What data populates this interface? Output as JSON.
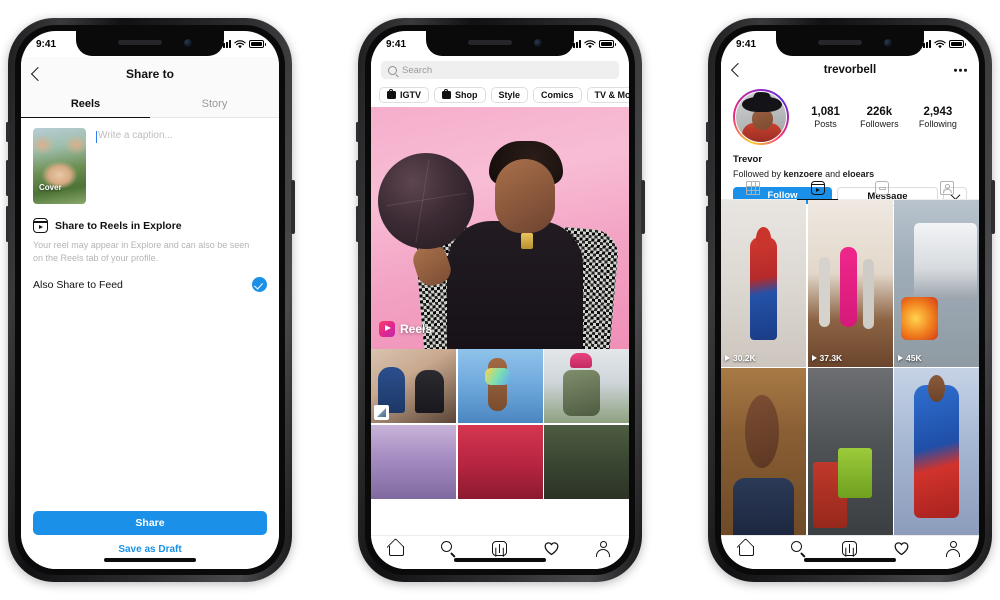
{
  "status_bar": {
    "time": "9:41",
    "signal_icon": "cellular-bars-icon",
    "wifi_icon": "wifi-icon",
    "battery_icon": "battery-icon"
  },
  "phone1": {
    "header": {
      "back_icon": "back-chevron-icon",
      "title": "Share to"
    },
    "tabs": [
      {
        "label": "Reels",
        "active": true
      },
      {
        "label": "Story",
        "active": false
      }
    ],
    "composer": {
      "cover_label": "Cover",
      "caption_placeholder": "Write a caption...",
      "caption_value": ""
    },
    "explore": {
      "icon": "reels-icon",
      "title": "Share to Reels in Explore",
      "description": "Your reel may appear in Explore and can also be seen on the Reels tab of your profile."
    },
    "feed_toggle": {
      "label": "Also Share to Feed",
      "checked": true,
      "check_icon": "check-circle-icon"
    },
    "actions": {
      "share_label": "Share",
      "draft_label": "Save as Draft"
    },
    "colors": {
      "accent": "#1a90e8"
    }
  },
  "phone2": {
    "search": {
      "icon": "search-icon",
      "placeholder": "Search",
      "value": ""
    },
    "chips": [
      {
        "label": "IGTV",
        "icon": "igtv-icon"
      },
      {
        "label": "Shop",
        "icon": "shop-bag-icon"
      },
      {
        "label": "Style",
        "icon": ""
      },
      {
        "label": "Comics",
        "icon": ""
      },
      {
        "label": "TV & Movies",
        "icon": ""
      }
    ],
    "hero": {
      "badge_label": "Reels",
      "badge_icon": "reels-icon"
    },
    "grid": [
      {
        "name": "photo-two-people-cake",
        "art": "h1",
        "tag_icon": "tagged-photo-icon"
      },
      {
        "name": "photo-glitter-hand-sky",
        "art": "h2",
        "tag_icon": ""
      },
      {
        "name": "photo-person-beanie",
        "art": "h3",
        "tag_icon": ""
      },
      {
        "name": "photo-flowers",
        "art": "h4",
        "tag_icon": ""
      },
      {
        "name": "photo-red-dress",
        "art": "h5",
        "tag_icon": ""
      },
      {
        "name": "photo-dark-green",
        "art": "h6",
        "tag_icon": ""
      }
    ],
    "nav": [
      {
        "name": "home-icon",
        "active": true
      },
      {
        "name": "search-icon",
        "active": false
      },
      {
        "name": "add-post-icon",
        "active": false
      },
      {
        "name": "heart-icon",
        "active": false
      },
      {
        "name": "profile-icon",
        "active": false
      }
    ]
  },
  "phone3": {
    "header": {
      "back_icon": "back-chevron-icon",
      "username": "trevorbell",
      "more_icon": "more-options-icon"
    },
    "stats": [
      {
        "value": "1,081",
        "label": "Posts"
      },
      {
        "value": "226k",
        "label": "Followers"
      },
      {
        "value": "2,943",
        "label": "Following"
      }
    ],
    "bio": {
      "name": "Trevor",
      "followed_by_prefix": "Followed by ",
      "followed_by_1": "kenzoere",
      "followed_by_mid": " and ",
      "followed_by_2": "eloears"
    },
    "actions": {
      "follow_label": "Follow",
      "message_label": "Message",
      "chevron_icon": "chevron-down-icon"
    },
    "tabs": [
      {
        "name": "grid-tab-icon",
        "active": false
      },
      {
        "name": "reels-tab-icon",
        "active": true
      },
      {
        "name": "igtv-tab-icon",
        "active": false
      },
      {
        "name": "tagged-tab-icon",
        "active": false
      }
    ],
    "grid": [
      {
        "name": "reel-spiderman-hallway",
        "views": "30.2K",
        "art": "g1"
      },
      {
        "name": "reel-dance-workout",
        "views": "37.3K",
        "art": "g2"
      },
      {
        "name": "reel-bus-fire",
        "views": "45K",
        "art": "g3"
      },
      {
        "name": "reel-talking-head",
        "views": "",
        "art": "g4"
      },
      {
        "name": "reel-gym-box-jump",
        "views": "",
        "art": "g5"
      },
      {
        "name": "reel-superman",
        "views": "",
        "art": "g6"
      }
    ],
    "nav": [
      {
        "name": "home-icon"
      },
      {
        "name": "search-icon"
      },
      {
        "name": "add-post-icon"
      },
      {
        "name": "heart-icon"
      },
      {
        "name": "profile-icon"
      }
    ],
    "colors": {
      "accent": "#1a90e8"
    }
  }
}
